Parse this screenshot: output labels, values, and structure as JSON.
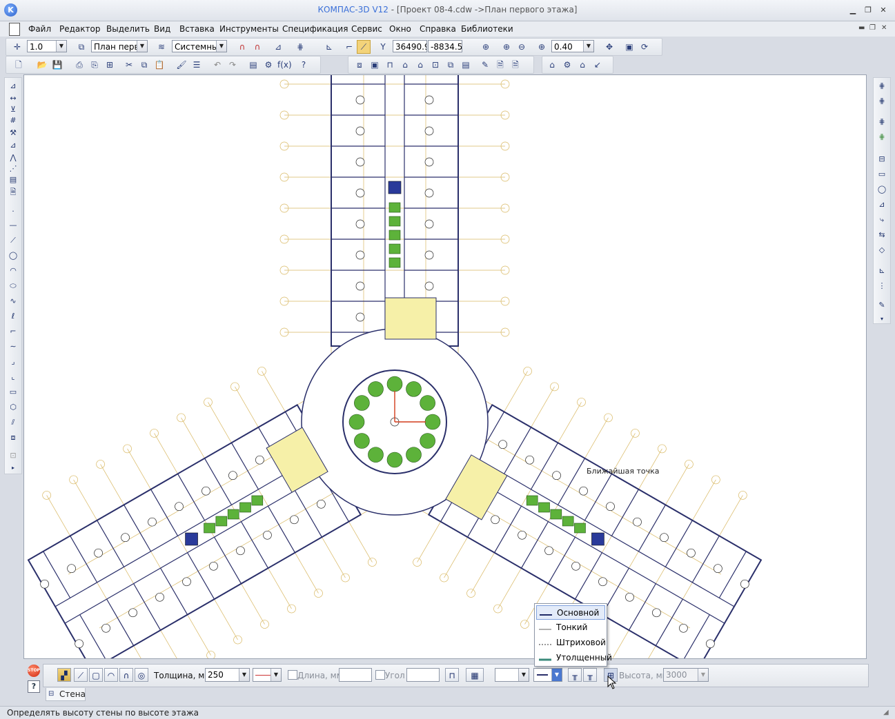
{
  "window": {
    "app_name": "КОМПАС-3D V12",
    "doc_title": " - [Проект 08-4.cdw ->План первого этажа]",
    "icon": "kompas-logo-icon"
  },
  "menu": [
    "Файл",
    "Редактор",
    "Выделить",
    "Вид",
    "Вставка",
    "Инструменты",
    "Спецификация",
    "Сервис",
    "Окно",
    "Справка",
    "Библиотеки"
  ],
  "toolbar_current": {
    "step": "1.0",
    "layer_state": "План перв",
    "coord_system": "Системный",
    "coord_x": "36490.9",
    "coord_y": "-8834.5",
    "zoom": "0.40"
  },
  "canvas": {
    "hint_label": "Ближайшая точка"
  },
  "line_styles": {
    "items": [
      "Основной",
      "Тонкий",
      "Штриховой",
      "Утолщенный"
    ],
    "selected": "Основной"
  },
  "properties": {
    "thickness_label": "Толщина, мм",
    "thickness_value": "250",
    "length_label": "Длина, мм",
    "length_value": "",
    "angle_label": "Угол",
    "angle_value": "",
    "height_label": "Высота, мм",
    "height_value": "3000",
    "tab_label": "Стена",
    "stop_label": "STOP",
    "help_label": "?"
  },
  "status": {
    "text": "Определять высоту стены по высоте этажа"
  },
  "colors": {
    "accent": "#3a6fd8",
    "plan_lines": "#2a2f6a",
    "axis_lines": "#d8b760",
    "room_yellow": "#f6f0a8",
    "plant_green": "#5db23a",
    "stair_blue": "#2a3a9a"
  }
}
